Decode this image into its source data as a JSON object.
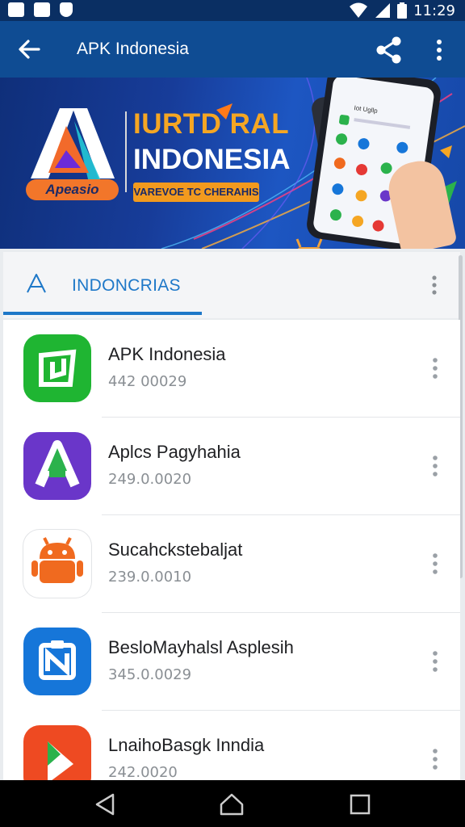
{
  "status_bar": {
    "time": "11:29",
    "icons": [
      "gallery-icon",
      "gallery-icon",
      "shield-icon",
      "wifi-icon",
      "signal-icon",
      "battery-icon"
    ]
  },
  "app_bar": {
    "title": "APK Indonesia",
    "back_icon": "arrow-left-icon",
    "share_icon": "share-icon",
    "more_icon": "more-vertical-icon",
    "color": "#0f4c93"
  },
  "banner": {
    "logo_text": "Apeasio",
    "headline_line1": "IURTD RAL",
    "headline_line2": "INDONESIA",
    "pill_text": "VAREVOE TC CHERAHIS",
    "phone_header": "Iot Ugllp"
  },
  "section": {
    "label": "INDONCRIAS",
    "icon": "a-letter-icon",
    "accent": "#1e78c8"
  },
  "apps": [
    {
      "name": "APK Indonesia",
      "version": "442 00029",
      "icon": "green-app-icon",
      "color": "#1fb532"
    },
    {
      "name": "Aplcs Pagyhahia",
      "version": "249.0.0020",
      "icon": "purple-a-icon",
      "color": "#6a36c9"
    },
    {
      "name": "Sucahckstebaljat",
      "version": "239.0.0010",
      "icon": "android-robot-icon",
      "color": "#f06a1f"
    },
    {
      "name": "BesloMayhalsl Asplesih",
      "version": "345.0.0029",
      "icon": "blue-n-icon",
      "color": "#1676d9"
    },
    {
      "name": "LnaihoBasgk Inndia",
      "version": "242.0020",
      "icon": "red-play-icon",
      "color": "#ee4a22"
    }
  ],
  "nav_bar": {
    "back": "triangle-back-icon",
    "home": "home-icon",
    "recents": "square-recents-icon"
  }
}
